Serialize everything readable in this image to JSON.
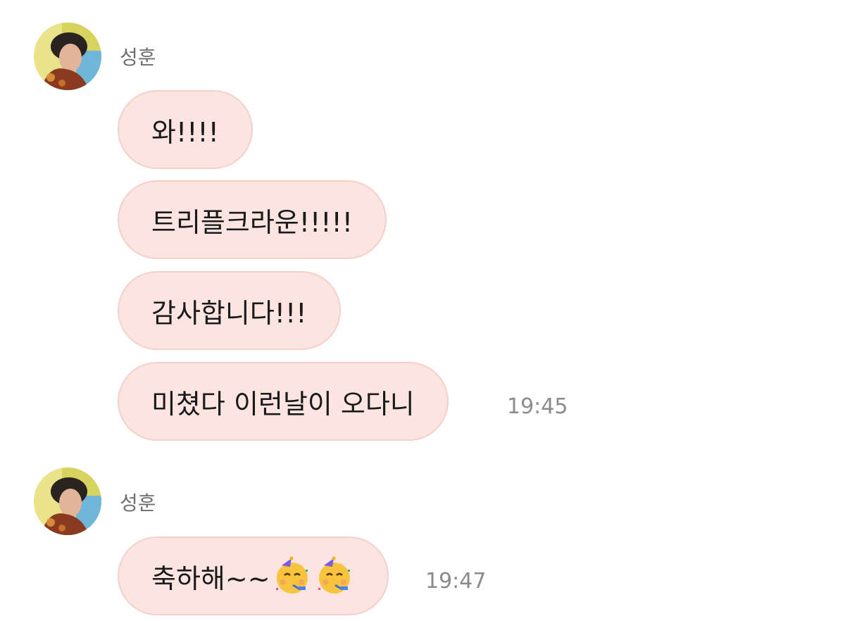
{
  "groups": [
    {
      "sender": "성훈",
      "messages": [
        {
          "text": "와!!!!"
        },
        {
          "text": "트리플크라운!!!!!"
        },
        {
          "text": "감사합니다!!!"
        },
        {
          "text": "미쳤다 이런날이 오다니"
        }
      ],
      "time": "19:45"
    },
    {
      "sender": "성훈",
      "messages": [
        {
          "text": "축하해~~",
          "emojis": [
            "partying-face-emoji",
            "partying-face-emoji"
          ]
        }
      ],
      "time": "19:47"
    }
  ],
  "colors": {
    "bubble_fill": "#fce5e1",
    "bubble_border": "#f6cfca",
    "timestamp": "#8b8b8b"
  }
}
